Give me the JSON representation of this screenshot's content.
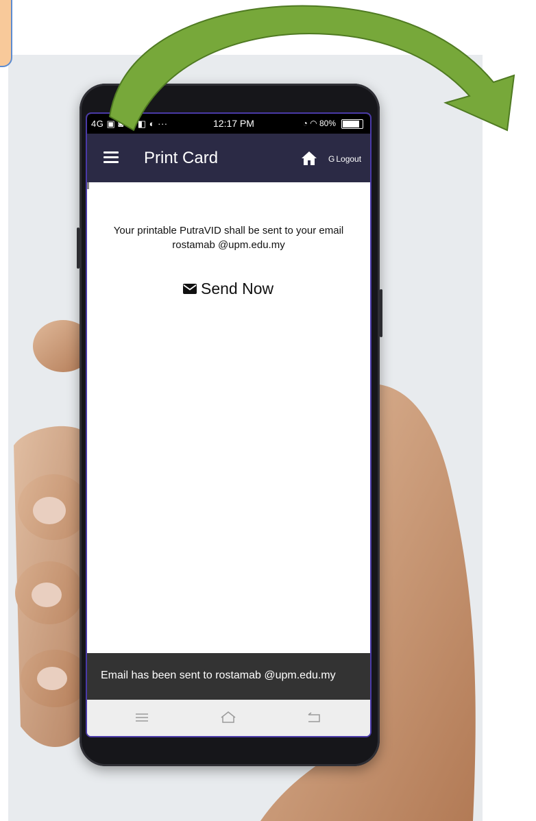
{
  "statusbar": {
    "left_indicators": "4G ▣ ◙ ◎ ◧ ◐ ···",
    "time": "12:17 PM",
    "right_indicators": "◔ ◠ 80%"
  },
  "appbar": {
    "title": "Print Card",
    "logout_label": "Logout",
    "logout_icon": "G"
  },
  "content": {
    "message_line1": "Your printable PutraVID shall be sent to your email",
    "message_line2": "rostamab @upm.edu.my",
    "send_label": "Send Now"
  },
  "snackbar": {
    "text": "Email has been sent to rostamab @upm.edu.my"
  },
  "icons": {
    "menu": "menu-icon",
    "home": "home-icon",
    "envelope": "envelope-icon",
    "nav_menu": "nav-menu-icon",
    "nav_home": "nav-home-icon",
    "nav_back": "nav-back-icon"
  },
  "colors": {
    "appbar": "#2b2a45",
    "snackbar": "#333333",
    "arrow": "#77a83a",
    "tab": "#f8c99a"
  }
}
